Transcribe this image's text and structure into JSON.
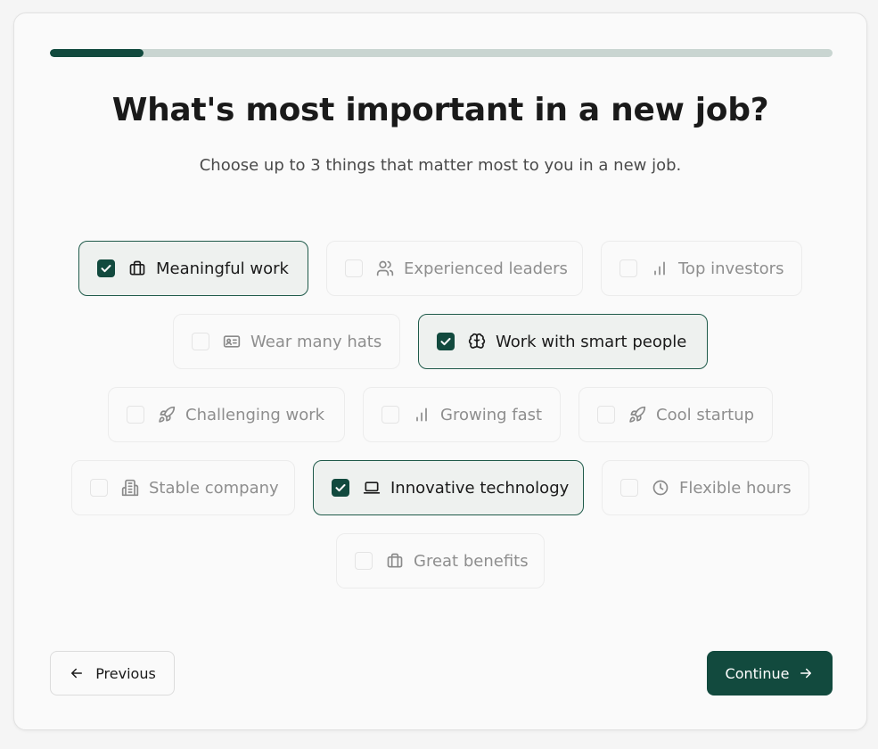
{
  "progress": {
    "value": 0.12
  },
  "header": {
    "title": "What's most important in a new job?",
    "subtitle": "Choose up to 3 things that matter most to you in a new job."
  },
  "colors": {
    "accent": "#124a3e",
    "track": "#c9d5d1",
    "selected_border": "#1f5a4a"
  },
  "options": {
    "meaningful_work": {
      "label": "Meaningful work",
      "icon": "briefcase-icon",
      "selected": true
    },
    "experienced_leaders": {
      "label": "Experienced leaders",
      "icon": "users-icon",
      "selected": false
    },
    "top_investors": {
      "label": "Top investors",
      "icon": "bar-chart-icon",
      "selected": false
    },
    "wear_many_hats": {
      "label": "Wear many hats",
      "icon": "id-card-icon",
      "selected": false
    },
    "work_with_smart_people": {
      "label": "Work with smart people",
      "icon": "brain-icon",
      "selected": true
    },
    "challenging_work": {
      "label": "Challenging work",
      "icon": "rocket-icon",
      "selected": false
    },
    "growing_fast": {
      "label": "Growing fast",
      "icon": "bar-chart-icon",
      "selected": false
    },
    "cool_startup": {
      "label": "Cool startup",
      "icon": "rocket-icon",
      "selected": false
    },
    "stable_company": {
      "label": "Stable company",
      "icon": "building-icon",
      "selected": false
    },
    "innovative_technology": {
      "label": "Innovative technology",
      "icon": "laptop-icon",
      "selected": true
    },
    "flexible_hours": {
      "label": "Flexible hours",
      "icon": "clock-icon",
      "selected": false
    },
    "great_benefits": {
      "label": "Great benefits",
      "icon": "briefcase-icon",
      "selected": false
    }
  },
  "nav": {
    "previous_label": "Previous",
    "continue_label": "Continue"
  }
}
